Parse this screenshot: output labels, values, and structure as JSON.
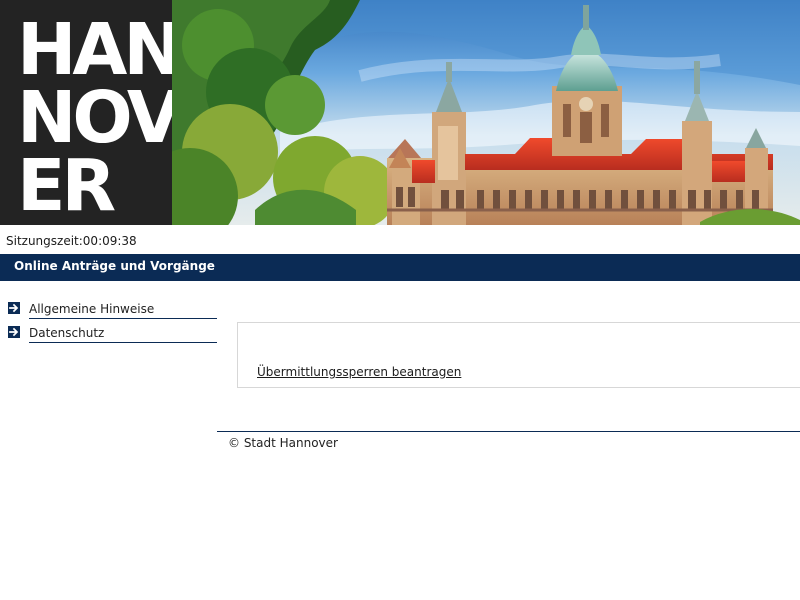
{
  "header": {
    "logo_text_lines": [
      "HAN",
      "NOV",
      "ER"
    ],
    "brand_colors": {
      "dark_panel": "#232323",
      "blue": "#1b6bb6",
      "red": "#d7131f",
      "sky": "#6ea3d8"
    },
    "image_subject": "city-hall-icon"
  },
  "session": {
    "label": "Sitzungszeit:",
    "time": "00:09:38",
    "text": "Sitzungszeit:00:09:38"
  },
  "page": {
    "title": "Online Anträge und Vorgänge"
  },
  "sidebar": {
    "items": [
      {
        "label": "Allgemeine Hinweise",
        "icon": "arrow-right-icon"
      },
      {
        "label": "Datenschutz",
        "icon": "arrow-right-icon"
      }
    ]
  },
  "main": {
    "action_link": "Übermittlungssperren beantragen"
  },
  "footer": {
    "text": "© Stadt Hannover"
  },
  "colors": {
    "nav_bar": "#0b2b55",
    "border": "#d7d7d7",
    "text": "#222222"
  }
}
